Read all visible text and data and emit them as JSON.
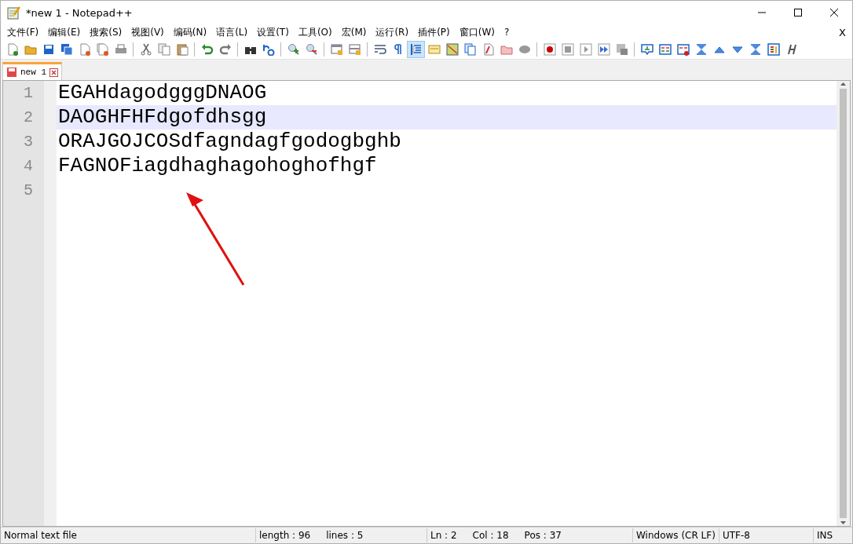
{
  "window": {
    "title": "*new 1 - Notepad++"
  },
  "menu": [
    "文件(F)",
    "编辑(E)",
    "搜索(S)",
    "视图(V)",
    "编码(N)",
    "语言(L)",
    "设置(T)",
    "工具(O)",
    "宏(M)",
    "运行(R)",
    "插件(P)",
    "窗口(W)",
    "?"
  ],
  "menu_close": "X",
  "toolbar": [
    [
      {
        "pressed": false
      },
      {
        "pressed": false
      },
      {
        "pressed": false
      },
      {
        "pressed": false
      },
      {
        "pressed": false
      },
      {
        "pressed": false
      },
      {
        "pressed": false
      }
    ],
    [
      {
        "pressed": false
      },
      {
        "pressed": false
      },
      {
        "pressed": false
      }
    ],
    [
      {
        "pressed": false
      },
      {
        "pressed": false
      }
    ],
    [
      {
        "pressed": false
      },
      {
        "pressed": false
      }
    ],
    [
      {
        "pressed": false
      },
      {
        "pressed": false
      }
    ],
    [
      {
        "pressed": false
      },
      {
        "pressed": false
      }
    ],
    [
      {
        "pressed": false
      },
      {
        "pressed": false
      },
      {
        "pressed": true
      },
      {
        "pressed": false
      },
      {
        "pressed": false
      },
      {
        "pressed": false
      },
      {
        "pressed": false
      },
      {
        "pressed": false
      },
      {
        "pressed": false
      }
    ],
    [
      {
        "pressed": false
      },
      {
        "pressed": false
      },
      {
        "pressed": false
      },
      {
        "pressed": false
      },
      {
        "pressed": false
      }
    ],
    [
      {
        "pressed": false
      },
      {
        "pressed": false
      },
      {
        "pressed": false
      },
      {
        "pressed": false
      },
      {
        "pressed": false
      },
      {
        "pressed": false
      },
      {
        "pressed": false
      },
      {
        "pressed": false
      },
      {
        "pressed": false
      }
    ]
  ],
  "tabs": [
    {
      "label": "new 1",
      "selected": true
    }
  ],
  "editor": {
    "lines": [
      {
        "number": "1",
        "text": "EGAHdagodgggDNAOG",
        "selected": false
      },
      {
        "number": "2",
        "text": "DAOGHFHFdgofdhsgg",
        "selected": true
      },
      {
        "number": "3",
        "text": "ORAJGOJCOSdfagndagfgodogbghb",
        "selected": false
      },
      {
        "number": "4",
        "text": "FAGNOFiagdhaghagohoghofhgf",
        "selected": false
      },
      {
        "number": "5",
        "selected": false
      }
    ]
  },
  "status_bar": {
    "file_type": "Normal text file",
    "length": "length : 96",
    "lines": "lines : 5",
    "ln": "Ln : 2",
    "col": "Col : 18",
    "pos": "Pos : 37",
    "eol": "Windows (CR LF)",
    "encoding": "UTF-8",
    "mode": "INS"
  }
}
